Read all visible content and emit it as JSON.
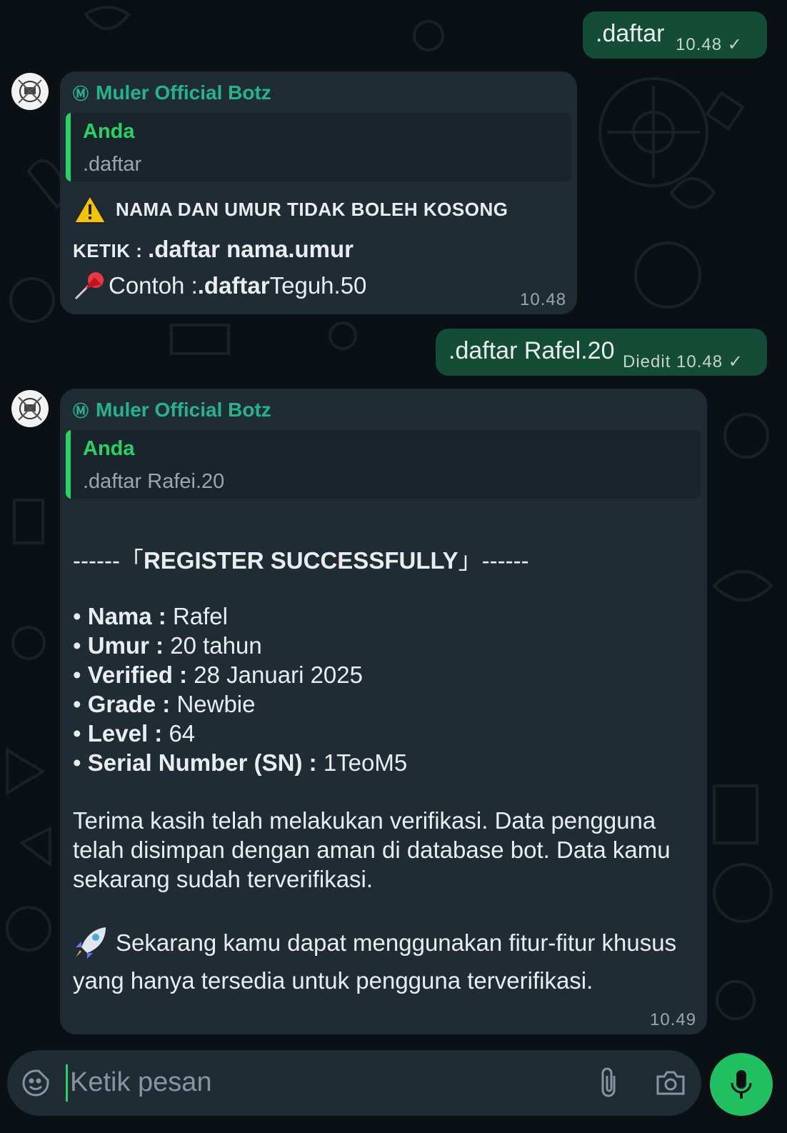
{
  "messages": {
    "out1": {
      "text": ".daftar",
      "time": "10.48 ✓"
    },
    "in1": {
      "sender": "Muler Official Botz",
      "quote_author": "Anda",
      "quote_text": ".daftar",
      "warning": "NAMA DAN UMUR TIDAK BOLEH KOSONG",
      "ketik_label": "KETIK : ",
      "ketik_cmd": ".daftar nama.umur",
      "contoh_label": "Contoh : ",
      "contoh_cmd": ".daftar",
      "contoh_value": " Teguh.50",
      "time": "10.48"
    },
    "out2": {
      "text": ".daftar Rafel.20",
      "time": "Diedit 10.48 ✓"
    },
    "in2": {
      "sender": "Muler Official Botz",
      "quote_author": "Anda",
      "quote_text": ".daftar Rafei.20",
      "header_left": "------「",
      "header_title": "REGISTER SUCCESSFULLY",
      "header_right": "」------",
      "fields": [
        {
          "label": "Nama",
          "value": "Rafel"
        },
        {
          "label": "Umur",
          "value": "20 tahun"
        },
        {
          "label": "Verified",
          "value": "28 Januari 2025"
        },
        {
          "label": "Grade",
          "value": "Newbie"
        },
        {
          "label": "Level",
          "value": "64"
        },
        {
          "label": "Serial Number (SN)",
          "value": "1TeoM5"
        }
      ],
      "thanks_lines": [
        "Terima kasih telah melakukan verifikasi. Data pengguna",
        "telah disimpan dengan aman di database bot. Data kamu",
        "sekarang sudah terverifikasi."
      ],
      "rocket_line1": "Sekarang kamu dapat menggunakan fitur-fitur khusus",
      "rocket_line2": "yang hanya tersedia untuk pengguna terverifikasi.",
      "time": "10.49"
    }
  },
  "input": {
    "placeholder": "Ketik pesan"
  },
  "icons": [
    "sticker-icon",
    "attach-icon",
    "camera-icon",
    "mic-icon",
    "warning-icon",
    "pushpin-icon",
    "rocket-icon"
  ],
  "colors": {
    "background": "#0b1014",
    "outgoing_bubble": "#144d37",
    "incoming_bubble": "#1f2c33",
    "sender": "#25b38a",
    "accent": "#25d366",
    "mic_button": "#21c063"
  }
}
